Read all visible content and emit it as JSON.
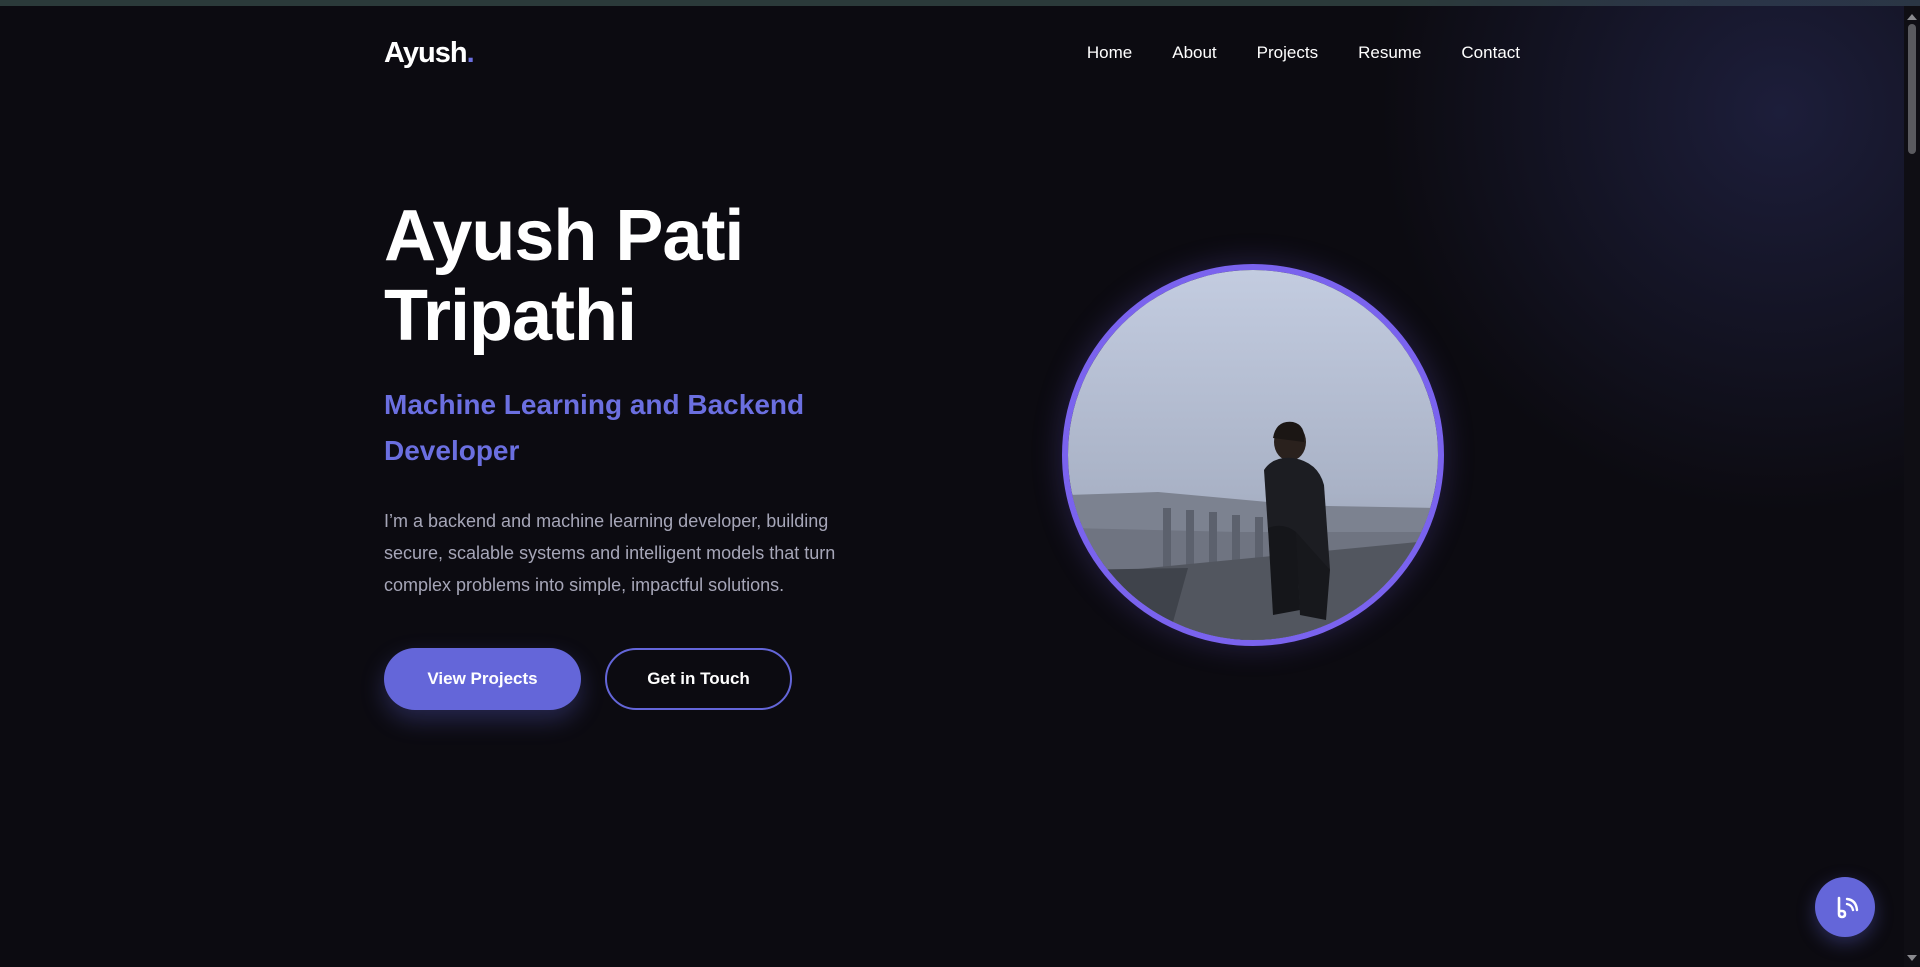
{
  "header": {
    "logo_text": "Ayush",
    "logo_dot": ".",
    "nav": [
      "Home",
      "About",
      "Projects",
      "Resume",
      "Contact"
    ]
  },
  "hero": {
    "title_line1": "Ayush Pati",
    "title_line2": "Tripathi",
    "subtitle": "Machine Learning and Backend Developer",
    "description": "I’m a backend and machine learning developer, building secure, scalable systems and intelligent models that turn complex problems into simple, impactful solutions.",
    "primary_button": "View Projects",
    "secondary_button": "Get in Touch"
  },
  "profile_photo": {
    "icon": "profile-photo"
  },
  "floating_button": {
    "icon": "chat-widget-icon"
  },
  "colors": {
    "background": "#0c0b11",
    "accent": "#6466d9",
    "ring": "#7a63ee",
    "muted_text": "#a6a6b8"
  }
}
